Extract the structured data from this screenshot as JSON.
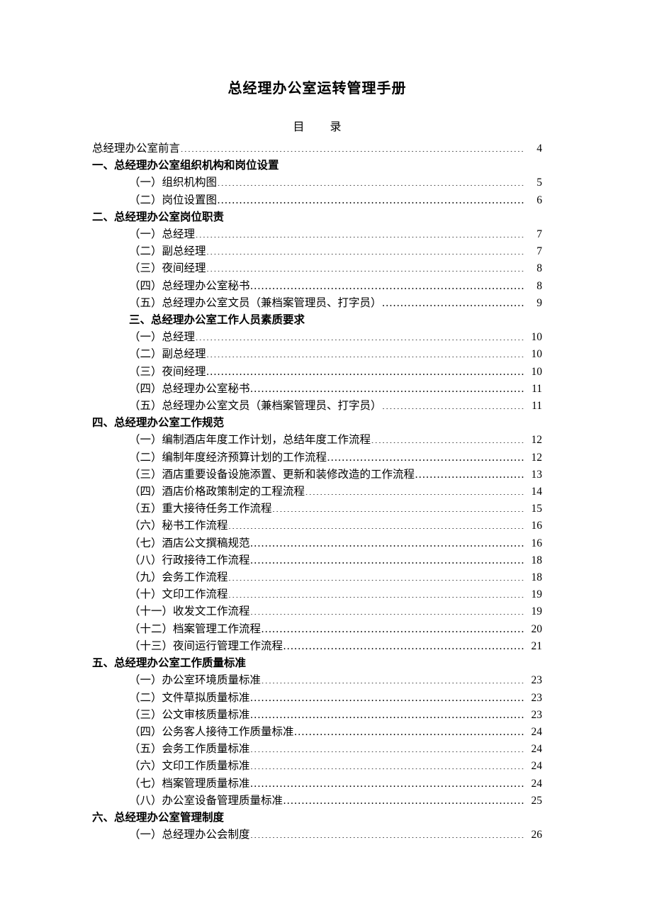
{
  "title": "总经理办公室运转管理手册",
  "toc_heading_left": "目",
  "toc_heading_right": "录",
  "toc": [
    {
      "level": 0,
      "kind": "entry",
      "label": "总经理办公室前言",
      "page": "4"
    },
    {
      "level": 0,
      "kind": "heading",
      "label": "一、总经理办公室组织机构和岗位设置"
    },
    {
      "level": 1,
      "kind": "entry",
      "label": "（一）组织机构图",
      "page": "5"
    },
    {
      "level": 1,
      "kind": "entry",
      "label": "（二）岗位设置图",
      "page": "6"
    },
    {
      "level": 0,
      "kind": "heading",
      "label": "二、总经理办公室岗位职责"
    },
    {
      "level": 1,
      "kind": "entry",
      "label": "（一）总经理",
      "page": "7"
    },
    {
      "level": 1,
      "kind": "entry",
      "label": "（二）副总经理",
      "page": "7"
    },
    {
      "level": 1,
      "kind": "entry",
      "label": "（三）夜间经理",
      "page": "8"
    },
    {
      "level": 1,
      "kind": "entry",
      "label": "（四）总经理办公室秘书",
      "page": "8"
    },
    {
      "level": 1,
      "kind": "entry",
      "label": "（五）总经理办公室文员（兼档案管理员、打字员）",
      "page": "9"
    },
    {
      "level": 1,
      "kind": "heading",
      "label": "三、总经理办公室工作人员素质要求"
    },
    {
      "level": 1,
      "kind": "entry",
      "label": "（一）总经理",
      "page": "10"
    },
    {
      "level": 1,
      "kind": "entry",
      "label": "（二）副总经理",
      "page": "10"
    },
    {
      "level": 1,
      "kind": "entry",
      "label": "（三）夜间经理",
      "page": "10"
    },
    {
      "level": 1,
      "kind": "entry",
      "label": "（四）总经理办公室秘书",
      "page": "11"
    },
    {
      "level": 1,
      "kind": "entry",
      "label": "（五）总经理办公室文员（兼档案管理员、打字员）",
      "page": "11"
    },
    {
      "level": 0,
      "kind": "heading",
      "label": "四、总经理办公室工作规范"
    },
    {
      "level": 1,
      "kind": "entry",
      "label": "（一）编制酒店年度工作计划，总结年度工作流程",
      "page": "12"
    },
    {
      "level": 1,
      "kind": "entry",
      "label": "（二）编制年度经济预算计划的工作流程",
      "page": "12"
    },
    {
      "level": 1,
      "kind": "entry",
      "label": "（三）酒店重要设备设施添置、更新和装修改造的工作流程",
      "page": "13"
    },
    {
      "level": 1,
      "kind": "entry",
      "label": "（四）酒店价格政策制定的工程流程",
      "page": "14"
    },
    {
      "level": 1,
      "kind": "entry",
      "label": "（五）重大接待任务工作流程",
      "page": "15"
    },
    {
      "level": 1,
      "kind": "entry",
      "label": "（六）秘书工作流程",
      "page": "16"
    },
    {
      "level": 1,
      "kind": "entry",
      "label": "（七）酒店公文撰稿规范",
      "page": "16"
    },
    {
      "level": 1,
      "kind": "entry",
      "label": "（八）行政接待工作流程",
      "page": "18"
    },
    {
      "level": 1,
      "kind": "entry",
      "label": "（九）会务工作流程",
      "page": "18"
    },
    {
      "level": 1,
      "kind": "entry",
      "label": "（十）文印工作流程",
      "page": "19"
    },
    {
      "level": 1,
      "kind": "entry",
      "label": "（十一）收发文工作流程",
      "page": "19"
    },
    {
      "level": 1,
      "kind": "entry",
      "label": "（十二）档案管理工作流程",
      "page": "20"
    },
    {
      "level": 1,
      "kind": "entry",
      "label": "（十三）夜间运行管理工作流程",
      "page": "21"
    },
    {
      "level": 0,
      "kind": "heading",
      "label": "五、总经理办公室工作质量标准"
    },
    {
      "level": 1,
      "kind": "entry",
      "label": "（一）办公室环境质量标准",
      "page": "23"
    },
    {
      "level": 1,
      "kind": "entry",
      "label": "（二）文件草拟质量标准",
      "page": "23"
    },
    {
      "level": 1,
      "kind": "entry",
      "label": "（三）公文审核质量标准",
      "page": "23"
    },
    {
      "level": 1,
      "kind": "entry",
      "label": "（四）公务客人接待工作质量标准",
      "page": "24"
    },
    {
      "level": 1,
      "kind": "entry",
      "label": "（五）会务工作质量标准",
      "page": "24"
    },
    {
      "level": 1,
      "kind": "entry",
      "label": "（六）文印工作质量标准",
      "page": "24"
    },
    {
      "level": 1,
      "kind": "entry",
      "label": "（七）档案管理质量标准",
      "page": "24"
    },
    {
      "level": 1,
      "kind": "entry",
      "label": "（八）办公室设备管理质量标准",
      "page": "25"
    },
    {
      "level": 0,
      "kind": "heading",
      "label": "六、总经理办公室管理制度"
    },
    {
      "level": 1,
      "kind": "entry",
      "label": "（一）总经理办公会制度",
      "page": "26"
    }
  ]
}
